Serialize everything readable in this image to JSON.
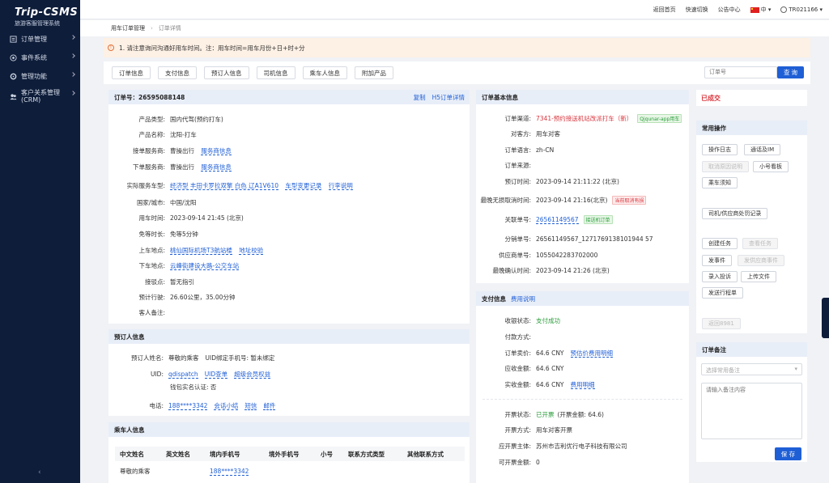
{
  "app": {
    "logo_title": "Trip-CSMS",
    "logo_subtitle": "旅游客服管理系统"
  },
  "sidebar": {
    "items": [
      {
        "label": "订单管理",
        "icon": "order-icon"
      },
      {
        "label": "事件系统",
        "icon": "event-icon"
      },
      {
        "label": "管理功能",
        "icon": "manage-icon"
      },
      {
        "label": "客户关系管理(CRM)",
        "label_line1": "客户关系管理",
        "label_line2": "(CRM)",
        "icon": "users-icon"
      }
    ],
    "collapse": "‹"
  },
  "topbar": {
    "home": "返回首页",
    "quick_switch": "快速切换",
    "announcements": "公告中心",
    "language": "中",
    "user": "TR021166"
  },
  "breadcrumb": {
    "parent": "用车订单管理",
    "current": "订单详情"
  },
  "notice": {
    "text": "1. 请注意询问沟通好用车时间。注：用车时间=用车月份+日+时+分"
  },
  "tabs": [
    "订单信息",
    "支付信息",
    "预订人信息",
    "司机信息",
    "乘车人信息",
    "附加产品"
  ],
  "search": {
    "placeholder": "订单号",
    "button": "查 询"
  },
  "order": {
    "header_label": "订单号：",
    "order_no": "26595088148",
    "copy": "复制",
    "h5": "H5订单详情",
    "fields": {
      "product_type": {
        "label": "产品类型:",
        "value": "国内代驾(预约打车)"
      },
      "product_name": {
        "label": "产品名称:",
        "value": "沈阳-打车"
      },
      "accept_service": {
        "label": "接单服务商:",
        "value": "曹操出行",
        "link": "服务商信息"
      },
      "place_service": {
        "label": "下单服务商:",
        "value": "曹操出行",
        "link": "服务商信息"
      },
      "actual_service": {
        "label": "实际服务车型:",
        "value": "经济型 丰田卡罗拉双擎 白色 辽A1V610",
        "link1": "车型变更记录",
        "link2": "行李说明"
      },
      "city": {
        "label": "国家/城市:",
        "value": "中国/沈阳"
      },
      "use_time": {
        "label": "用车时间:",
        "value": "2023-09-14 21:45 (北京)"
      },
      "wait": {
        "label": "免等时长:",
        "value": "免等5分钟"
      },
      "pickup": {
        "label": "上车地点:",
        "value": "桃仙国际机场T3航站楼",
        "link": "地址校验"
      },
      "dropoff": {
        "label": "下车地点:",
        "value": "云峰街建设大路-公交车站"
      },
      "meet": {
        "label": "接驳点:",
        "value": "暂无指引"
      },
      "est": {
        "label": "预计行驶:",
        "value": "26.60公里，35.00分钟"
      },
      "remark": {
        "label": "客人备注:",
        "value": ""
      }
    }
  },
  "booker": {
    "title": "预订人信息",
    "name_label": "预订人姓名:",
    "name": "尊敬的乘客",
    "uid_phone": "UID绑定手机号: 暂未绑定",
    "uid_label": "UID:",
    "uid": "qdispatch",
    "uid_query": "UID查单",
    "vip": "超级会员权益",
    "wallet": "钱包实名认证: 否",
    "phone_label": "电话:",
    "phone": "188****3342",
    "call_summary": "会话小结",
    "sms": "短信",
    "mail": "邮件"
  },
  "passenger": {
    "title": "乘车人信息",
    "columns": [
      "中文姓名",
      "英文姓名",
      "境内手机号",
      "境外手机号",
      "小号",
      "联系方式类型",
      "其他联系方式"
    ],
    "rows": [
      {
        "cn_name": "尊敬的乘客",
        "en_name": "",
        "phone": "188****3342",
        "foreign_phone": "",
        "virtual": "",
        "contact_type": "",
        "other": ""
      }
    ]
  },
  "basic": {
    "title": "订单基本信息",
    "channel": {
      "label": "订单渠道:",
      "value": "7341-预约接送机站改派打车（新）",
      "tag": "Qjqunar-app用车"
    },
    "counterpart": {
      "label": "对客方:",
      "value": "用车对客"
    },
    "lang": {
      "label": "订单语言:",
      "value": "zh-CN"
    },
    "source": {
      "label": "订单来源:",
      "value": ""
    },
    "book_time": {
      "label": "预订时间:",
      "value": "2023-09-14 21:11:22 (北京)"
    },
    "cancel_time": {
      "label": "最晚无损取消时间:",
      "value": "2023-09-14 21:16(北京)",
      "tag": "当前取消有损"
    },
    "related": {
      "label": "关联单号:",
      "value": "26561149567",
      "tag": "接送机订单"
    },
    "dist": {
      "label": "分销单号:",
      "value": "26561149567_1271769138101944 57"
    },
    "supplier": {
      "label": "供应商单号:",
      "value": "1055042283702000"
    },
    "confirm": {
      "label": "最晚确认时间:",
      "value": "2023-09-14 21:26 (北京)"
    }
  },
  "payment": {
    "title": "支付信息",
    "link": "费用说明",
    "status": {
      "label": "收银状态:",
      "value": "支付成功"
    },
    "method": {
      "label": "付款方式:",
      "value": ""
    },
    "price": {
      "label": "订单卖价:",
      "value": "64.6 CNY",
      "link": "预估价费用明细"
    },
    "receivable": {
      "label": "应收金额:",
      "value": "64.6 CNY"
    },
    "received": {
      "label": "实收金额:",
      "value": "64.6 CNY",
      "link": "费用明细"
    },
    "invoice_status": {
      "label": "开票状态:",
      "value": "已开票",
      "amount": "(开票金额: 64.6)"
    },
    "invoice_method": {
      "label": "开票方式:",
      "value": "用车对客开票"
    },
    "invoice_entity": {
      "label": "应开票主体:",
      "value": "苏州市吉利优行电子科技有限公司"
    },
    "invoice_left": {
      "label": "可开票金额:",
      "value": "0"
    }
  },
  "right": {
    "status": "已成交",
    "ops_title": "常用操作",
    "ops": {
      "op_log": "操作日志",
      "im": "通话及IM",
      "cancel_explain": "取消原因说明",
      "small_board": "小号看板",
      "car_notice": "乘车须知",
      "driver_record": "司机/供应商处罚记录",
      "create_task": "创建任务",
      "view_task": "查看任务",
      "send_task": "发事件",
      "supplier_event": "发供应商事件",
      "complaint": "录入投诉",
      "upload": "上传文件",
      "send_trip": "发送行程单",
      "return": "返回8981"
    },
    "note_title": "订单备注",
    "note_select_placeholder": "选择常用备注",
    "note_textarea_placeholder": "请输入备注内容",
    "save": "保 存"
  },
  "colors": {
    "primary": "#1f5fd6",
    "sidebar": "#0e1d3a",
    "danger": "#d9363e",
    "success": "#2a9d3a",
    "panel_head": "#e8eef8"
  }
}
